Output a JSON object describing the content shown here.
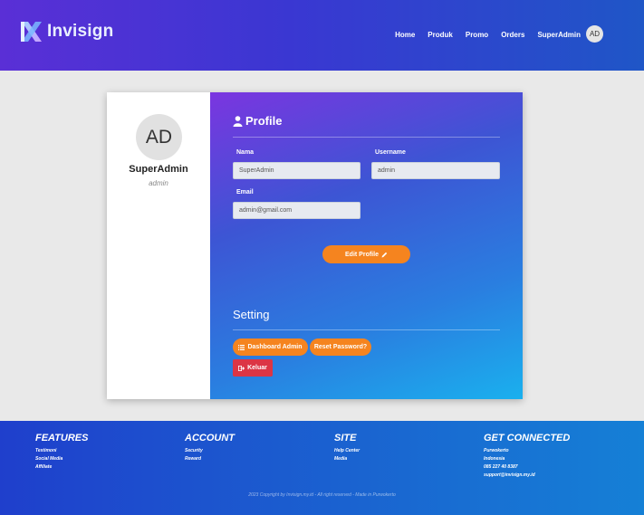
{
  "header": {
    "logo_text": "Invisign",
    "nav": [
      "Home",
      "Produk",
      "Promo",
      "Orders"
    ],
    "user_name": "SuperAdmin",
    "user_initials": "AD"
  },
  "sidebar": {
    "initials": "AD",
    "name": "SuperAdmin",
    "role": "admin"
  },
  "profile": {
    "title": "Profile",
    "nama_label": "Nama",
    "nama_value": "SuperAdmin",
    "username_label": "Username",
    "username_value": "admin",
    "email_label": "Email",
    "email_value": "admin@gmail.com",
    "edit_button": "Edit Profile"
  },
  "setting": {
    "title": "Setting",
    "dashboard_button": "Dashboard Admin",
    "reset_button": "Reset Password?",
    "logout_button": "Keluar"
  },
  "footer": {
    "columns": [
      {
        "title": "FEATURES",
        "items": [
          "Testimoni",
          "Social Media",
          "Affiliate"
        ]
      },
      {
        "title": "ACCOUNT",
        "items": [
          "Security",
          "Reward"
        ]
      },
      {
        "title": "SITE",
        "items": [
          "Help Center",
          "Media"
        ]
      },
      {
        "title": "GET CONNECTED",
        "items": [
          "Purwokerto",
          "Indonesia",
          "085 227 40 8387",
          "support@invisign.my.id"
        ]
      }
    ],
    "copyright": "2023 Copyright by Invisign.my.id - All right reserved - Made in Purwokerto"
  },
  "colors": {
    "accent_orange": "#f5841f",
    "danger_red": "#dc3545",
    "header_purple": "#5a2fd6"
  }
}
